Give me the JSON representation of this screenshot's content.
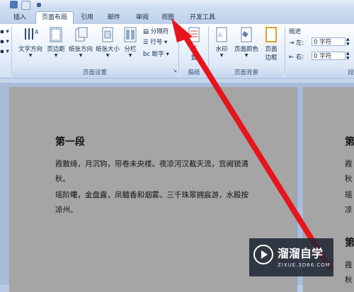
{
  "tabs": [
    {
      "label": "插入"
    },
    {
      "label": "页面布局"
    },
    {
      "label": "引用"
    },
    {
      "label": "邮件"
    },
    {
      "label": "审阅"
    },
    {
      "label": "视图"
    },
    {
      "label": "开发工具"
    }
  ],
  "active_tab": "页面布局",
  "ribbon": {
    "page_setup": {
      "text_direction": "文字方向",
      "margins": "页边距",
      "orientation": "纸张方向",
      "size": "纸张大小",
      "columns": "分栏",
      "breaks": "分隔符",
      "line_numbers": "行号",
      "hyphenation": "断字",
      "group_label": "页面设置"
    },
    "background": {
      "manuscript_top": "稿",
      "manuscript": "纸",
      "manuscript_bottom": "置",
      "group_label_partial": "稿纸",
      "watermark": "水印",
      "page_color": "页面颜色",
      "page_border_1": "页面",
      "page_border_2": "边框",
      "group_label": "页面背景"
    },
    "paragraph": {
      "indent_label": "缩进",
      "left_label": "左:",
      "left_value": "0 字符",
      "right_label": "右:",
      "right_value": "0 字符",
      "group_label_partial": "段"
    }
  },
  "document": {
    "heading": "第一段",
    "lines": [
      "霞散绮，月沉钩，帘卷未央楼。夜凉河汉截天流，宫阙锁清",
      "秋。",
      "瑶阶曙，金盘露，凤髓香和烟雾。三千珠翠拥宸游，水殿按",
      "凉州。"
    ],
    "right_page_chars": [
      "第",
      "霞",
      "秋",
      "瑶",
      "凉",
      "第",
      "霞",
      "秋"
    ]
  },
  "watermark": {
    "title": "溜溜自学",
    "url": "ZIXUE.3D66.COM"
  },
  "colors": {
    "arrow": "#e8141b",
    "page_gray": "#a5a5a5",
    "ribbon_blue": "#bdd0ea"
  }
}
